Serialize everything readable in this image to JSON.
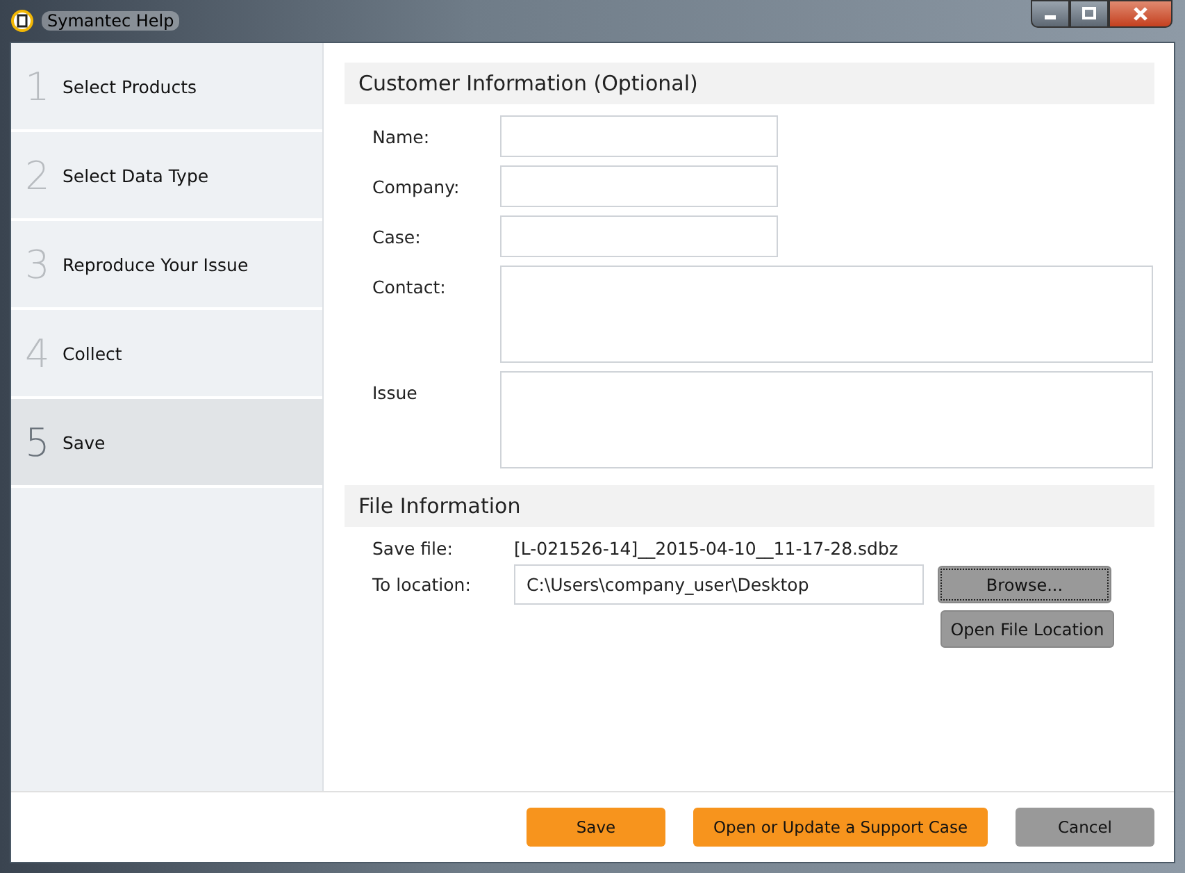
{
  "window": {
    "title": "Symantec Help"
  },
  "steps": [
    {
      "number": "1",
      "label": "Select Products",
      "selected": false
    },
    {
      "number": "2",
      "label": "Select Data Type",
      "selected": false
    },
    {
      "number": "3",
      "label": "Reproduce Your Issue",
      "selected": false
    },
    {
      "number": "4",
      "label": "Collect",
      "selected": false
    },
    {
      "number": "5",
      "label": "Save",
      "selected": true
    }
  ],
  "customer_section": {
    "title": "Customer Information (Optional)",
    "fields": [
      {
        "label": "Name:",
        "kind": "short"
      },
      {
        "label": "Company:",
        "kind": "short"
      },
      {
        "label": "Case:",
        "kind": "short"
      },
      {
        "label": "Contact:",
        "kind": "multi"
      },
      {
        "label": "Issue",
        "kind": "multi"
      }
    ]
  },
  "file_section": {
    "title": "File Information",
    "save_file_label": "Save file:",
    "save_file": "[L-021526-14]__2015-04-10__11-17-28.sdbz",
    "location_label": "To location:",
    "location": "C:\\Users\\company_user\\Desktop",
    "browse": "Browse...",
    "open_location": "Open File Location"
  },
  "footer_buttons": [
    {
      "label": "Save",
      "kind": "primary"
    },
    {
      "label": "Open or Update a Support Case",
      "kind": "primary"
    },
    {
      "label": "Cancel",
      "kind": "secondary"
    }
  ]
}
